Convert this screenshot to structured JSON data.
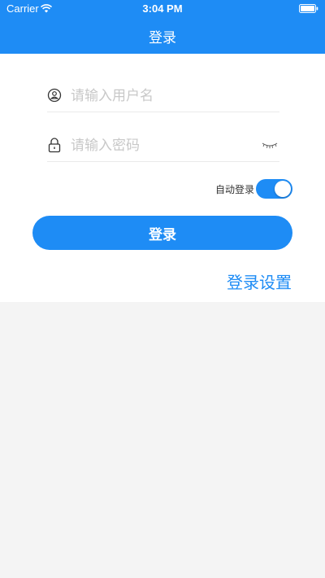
{
  "status_bar": {
    "carrier": "Carrier",
    "time": "3:04 PM"
  },
  "nav": {
    "title": "登录"
  },
  "form": {
    "username_placeholder": "请输入用户名",
    "username_icon": "user-circle-icon",
    "password_placeholder": "请输入密码",
    "password_icon": "lock-icon",
    "password_visibility_icon": "eye-closed-icon",
    "auto_login_label": "自动登录",
    "auto_login_enabled": true,
    "login_button_label": "登录",
    "settings_link_label": "登录设置"
  },
  "colors": {
    "primary": "#1e8cf5",
    "background": "#f4f4f4",
    "panel": "#ffffff",
    "placeholder": "#c8c8c8"
  }
}
